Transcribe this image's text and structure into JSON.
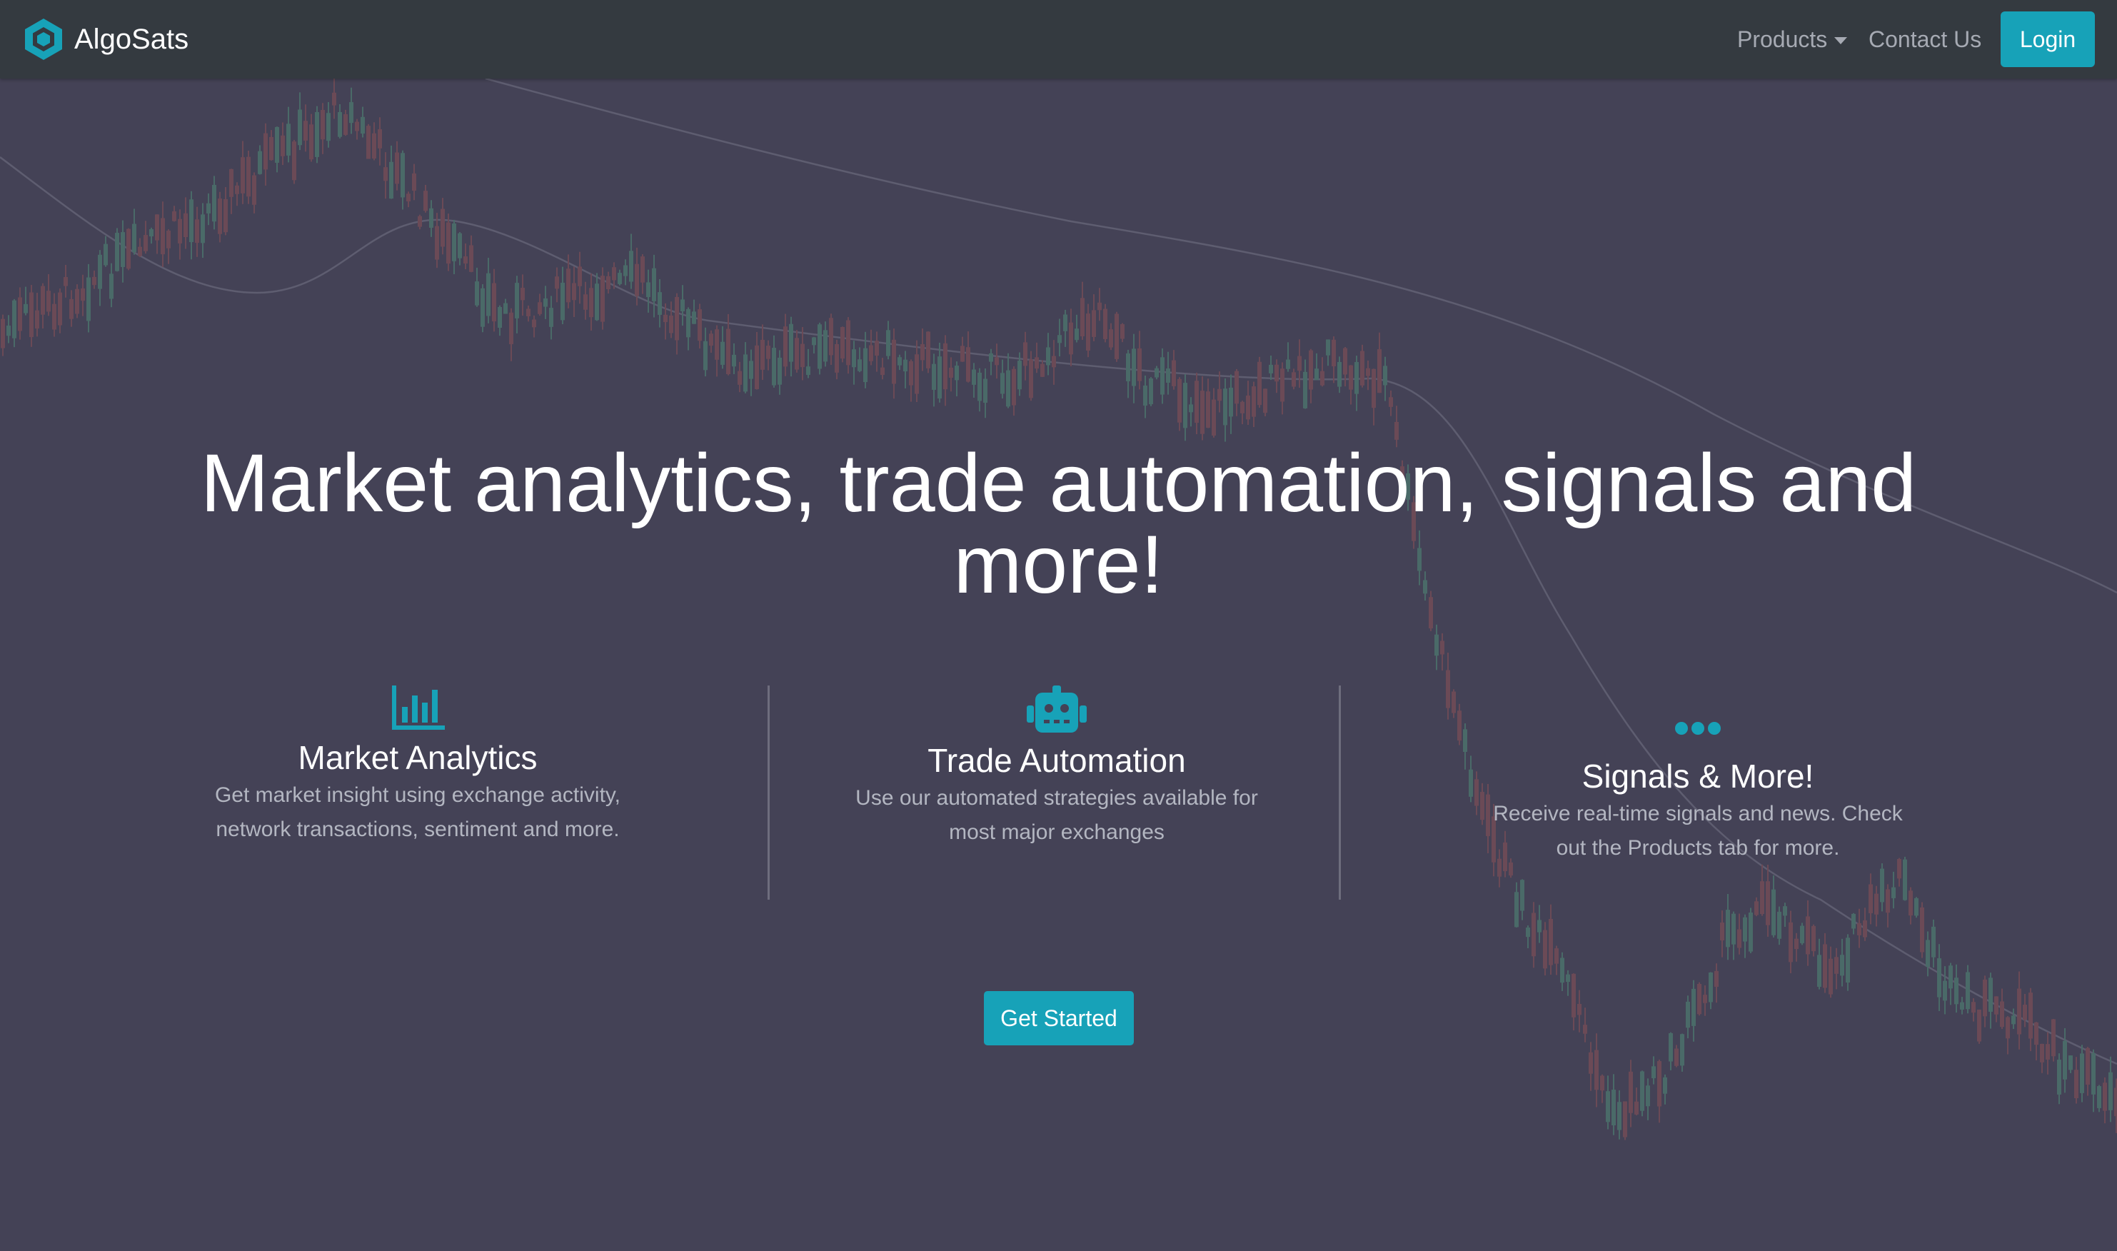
{
  "nav": {
    "brand": "AlgoSats",
    "products_label": "Products",
    "contact_label": "Contact Us",
    "login_label": "Login"
  },
  "hero": {
    "headline": "Market analytics, trade automation, signals and more!",
    "cta_label": "Get Started"
  },
  "features": [
    {
      "icon": "bar-chart-icon",
      "title": "Market Analytics",
      "description": "Get market insight using exchange activity, network transactions, sentiment and more."
    },
    {
      "icon": "robot-icon",
      "title": "Trade Automation",
      "description": "Use our automated strategies available for most major exchanges"
    },
    {
      "icon": "ellipsis-icon",
      "title": "Signals & More!",
      "description": "Receive real-time signals and news. Check out the Products tab for more."
    }
  ],
  "colors": {
    "accent": "#17a2b8",
    "navbar": "#343a40",
    "background": "#444256",
    "muted_text": "#b3b6c1",
    "candle_up": "#4a6a68",
    "candle_down": "#6b4a56"
  }
}
